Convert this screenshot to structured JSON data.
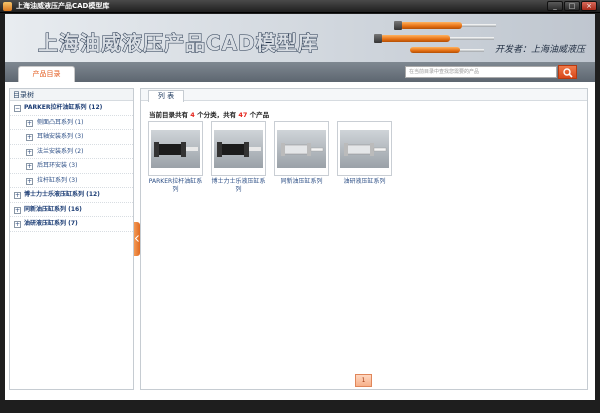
{
  "window": {
    "title": "上海油威液压产品CAD模型库",
    "controls": [
      "_",
      "□",
      "×"
    ]
  },
  "banner": {
    "title": "上海油威液压产品CAD模型库",
    "developer": "开发者：上海油威液压"
  },
  "tabbar": {
    "product_tab": "产品目录",
    "search_placeholder": "在当前目录中查找您需要的产品"
  },
  "tree": {
    "header": "目录树",
    "items": [
      {
        "label": "PARKER拉杆油缸系列 (12)",
        "toggle": "−",
        "level": 0
      },
      {
        "label": "侧面凸耳系列 (1)",
        "toggle": "+",
        "level": 1
      },
      {
        "label": "耳轴安装系列 (3)",
        "toggle": "+",
        "level": 1
      },
      {
        "label": "法兰安装系列 (2)",
        "toggle": "+",
        "level": 1
      },
      {
        "label": "后耳环安装 (3)",
        "toggle": "+",
        "level": 1
      },
      {
        "label": "拉杆缸系列 (3)",
        "toggle": "+",
        "level": 1
      },
      {
        "label": "博士力士乐液压缸系列 (12)",
        "toggle": "+",
        "level": 0
      },
      {
        "label": "同新油压缸系列 (16)",
        "toggle": "+",
        "level": 0
      },
      {
        "label": "油研液压缸系列 (7)",
        "toggle": "+",
        "level": 0
      }
    ]
  },
  "list": {
    "tab": "列 表",
    "summary_pre": "当前目录共有",
    "category_count": "4",
    "summary_mid": "个分类，共有",
    "product_count": "47",
    "summary_post": "个产品",
    "products": [
      {
        "label": "PARKER拉杆油缸系列",
        "style": "black"
      },
      {
        "label": "博士力士乐液压缸系列",
        "style": "black"
      },
      {
        "label": "同新油压缸系列",
        "style": "silver"
      },
      {
        "label": "油研液压缸系列",
        "style": "silver"
      }
    ],
    "page": "1"
  }
}
